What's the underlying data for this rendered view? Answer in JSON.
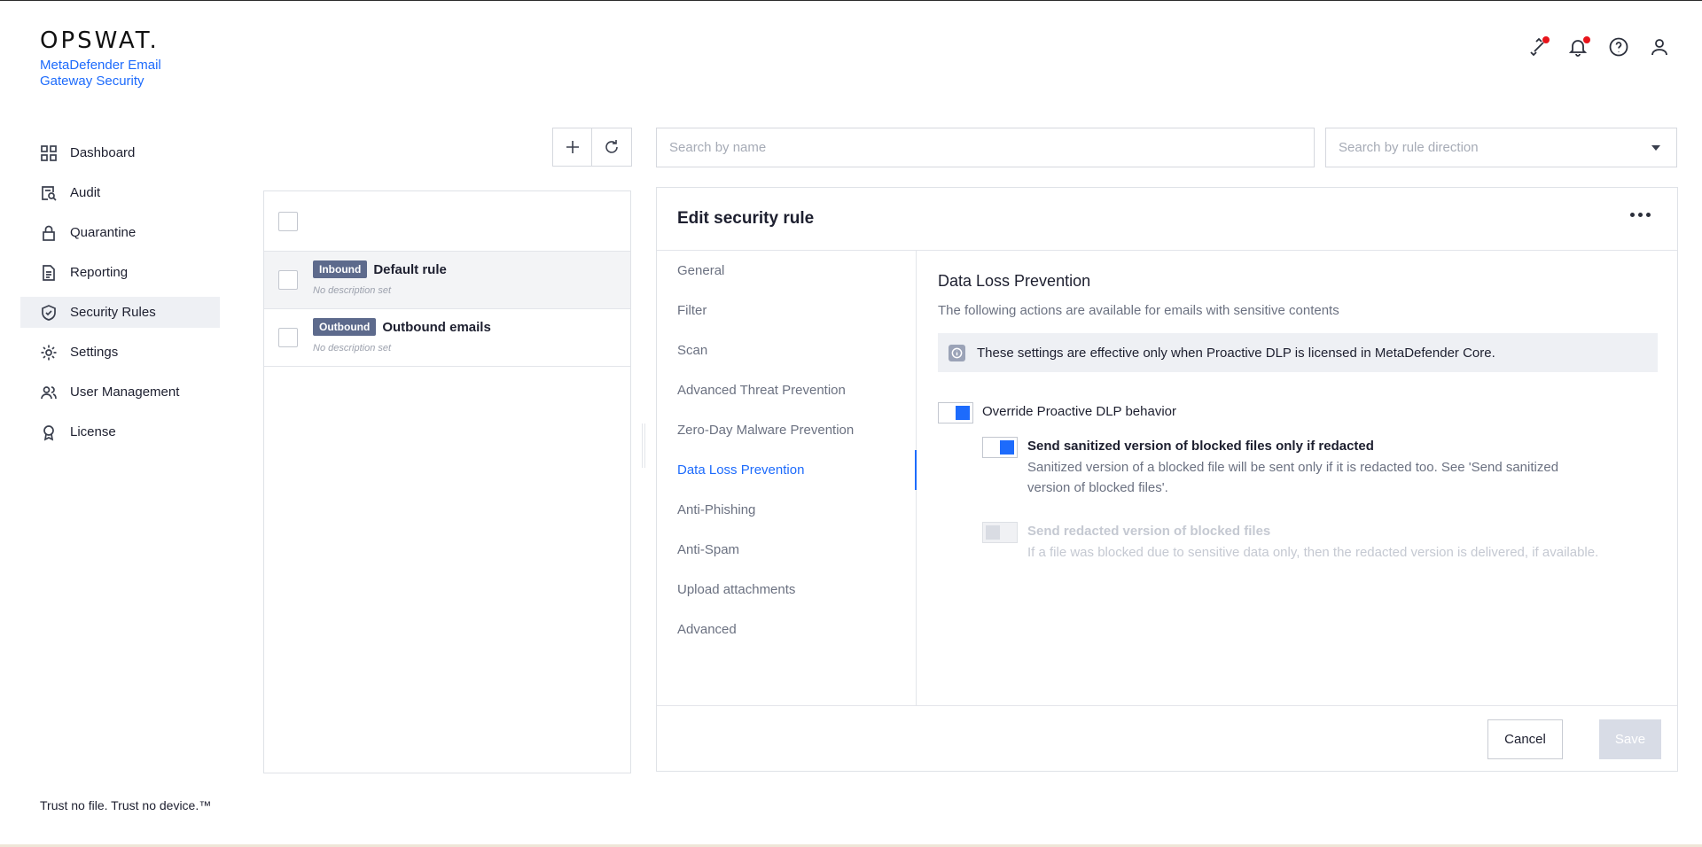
{
  "brand": {
    "logo": "OPSWAT.",
    "product": "MetaDefender Email Gateway Security"
  },
  "sidebar": {
    "items": [
      {
        "label": "Dashboard",
        "icon": "grid-icon"
      },
      {
        "label": "Audit",
        "icon": "audit-icon"
      },
      {
        "label": "Quarantine",
        "icon": "lock-icon"
      },
      {
        "label": "Reporting",
        "icon": "document-icon"
      },
      {
        "label": "Security Rules",
        "icon": "shield-check-icon",
        "active": true
      },
      {
        "label": "Settings",
        "icon": "gear-icon"
      },
      {
        "label": "User Management",
        "icon": "users-icon"
      },
      {
        "label": "License",
        "icon": "award-icon"
      }
    ],
    "tagline": "Trust no file. Trust no device.™"
  },
  "header": {
    "icons": [
      "connections-icon",
      "bell-icon",
      "help-icon",
      "user-icon"
    ],
    "notification_color": "#e8141b"
  },
  "rules": {
    "items": [
      {
        "direction": "Inbound",
        "name": "Default rule",
        "description": "No description set",
        "selected": true
      },
      {
        "direction": "Outbound",
        "name": "Outbound emails",
        "description": "No description set",
        "selected": false
      }
    ]
  },
  "search": {
    "name_placeholder": "Search by name",
    "direction_placeholder": "Search by rule direction"
  },
  "editor": {
    "title": "Edit security rule",
    "tabs": [
      "General",
      "Filter",
      "Scan",
      "Advanced Threat Prevention",
      "Zero-Day Malware Prevention",
      "Data Loss Prevention",
      "Anti-Phishing",
      "Anti-Spam",
      "Upload attachments",
      "Advanced"
    ],
    "active_tab": "Data Loss Prevention",
    "section": {
      "title": "Data Loss Prevention",
      "subtitle": "The following actions are available for emails with sensitive contents",
      "info": "These settings are effective only when Proactive DLP is licensed in MetaDefender Core.",
      "override_label": "Override Proactive DLP behavior",
      "override_on": true,
      "option1": {
        "label": "Send sanitized version of blocked files only if redacted",
        "description": "Sanitized version of a blocked file will be sent only if it is redacted too. See 'Send sanitized version of blocked files'.",
        "on": true
      },
      "option2": {
        "label": "Send redacted version of blocked files",
        "description": "If a file was blocked due to sensitive data only, then the redacted version is delivered, if available.",
        "on": false,
        "disabled": true
      }
    },
    "cancel_label": "Cancel",
    "save_label": "Save"
  },
  "colors": {
    "accent": "#1d6bfc",
    "badge": "#5d6a8c"
  }
}
